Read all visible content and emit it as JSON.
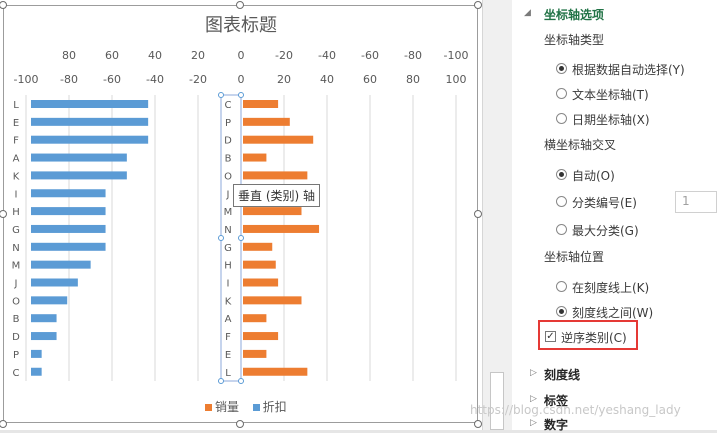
{
  "chart_data": {
    "type": "bar",
    "orientation": "horizontal",
    "title": "图表标题",
    "categories": [
      "C",
      "P",
      "D",
      "B",
      "O",
      "J",
      "M",
      "N",
      "G",
      "H",
      "I",
      "K",
      "A",
      "F",
      "E",
      "L"
    ],
    "left_axis": {
      "categories": [
        "L",
        "E",
        "F",
        "A",
        "K",
        "I",
        "H",
        "G",
        "N",
        "M",
        "J",
        "O",
        "B",
        "D",
        "P",
        "C"
      ],
      "primary_ticks": [
        "80",
        "60",
        "40",
        "20",
        "0",
        "-20",
        "-40",
        "-60",
        "-80",
        "-100"
      ],
      "secondary_ticks": [
        "-100",
        "-80",
        "-60",
        "-40",
        "-20",
        "0",
        "20",
        "40",
        "60",
        "80",
        "100"
      ]
    },
    "series": [
      {
        "name": "销量",
        "color": "#ed7d31",
        "values": [
          30,
          40,
          60,
          20,
          55,
          0,
          50,
          65,
          25,
          28,
          30,
          50,
          20,
          30,
          20,
          55
        ]
      },
      {
        "name": "折扣",
        "color": "#5b9bd5",
        "values": [
          -55,
          -55,
          -55,
          -45,
          -45,
          -35,
          -35,
          -35,
          -35,
          -28,
          -22,
          -17,
          -12,
          -12,
          -5,
          -5
        ]
      }
    ],
    "xlim_primary": [
      80,
      -100
    ],
    "xlim_secondary": [
      -100,
      100
    ],
    "grid": true,
    "legend_position": "bottom",
    "tooltip": "垂直 (类别) 轴"
  },
  "panel": {
    "section_axis_options": "坐标轴选项",
    "axis_type_label": "坐标轴类型",
    "axis_type_options": [
      {
        "label": "根据数据自动选择(Y)",
        "checked": true
      },
      {
        "label": "文本坐标轴(T)",
        "checked": false
      },
      {
        "label": "日期坐标轴(X)",
        "checked": false
      }
    ],
    "crosses_label": "横坐标轴交叉",
    "crosses_options": [
      {
        "label": "自动(O)",
        "checked": true
      },
      {
        "label": "分类编号(E)",
        "checked": false
      },
      {
        "label": "最大分类(G)",
        "checked": false
      }
    ],
    "crosses_value": "1",
    "position_label": "坐标轴位置",
    "position_options": [
      {
        "label": "在刻度线上(K)",
        "checked": false
      },
      {
        "label": "刻度线之间(W)",
        "checked": true
      }
    ],
    "reverse_label": "逆序类别(C)",
    "reverse_checked": true,
    "section_tick_marks": "刻度线",
    "section_labels": "标签",
    "section_number": "数字"
  },
  "watermark": "https://blog.csdn.net/yeshang_lady"
}
